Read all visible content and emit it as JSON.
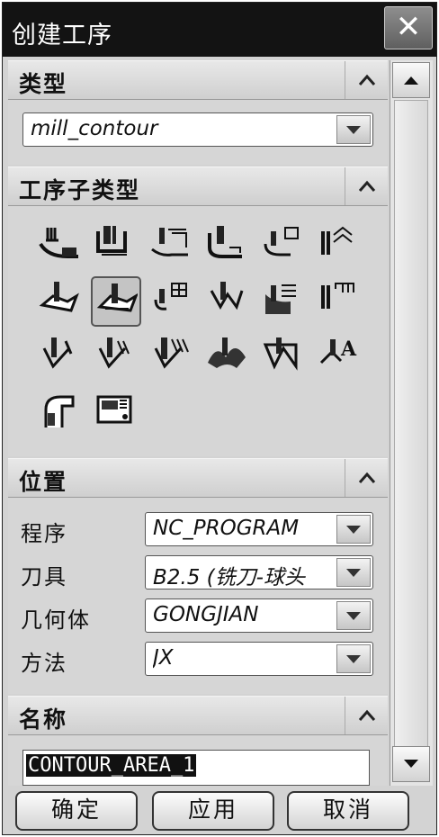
{
  "window": {
    "title": "创建工序",
    "close_label": "✕"
  },
  "sections": {
    "type": {
      "label": "类型",
      "selected_value": "mill_contour"
    },
    "subtype": {
      "label": "工序子类型",
      "icons": [
        "cavity-mill-icon",
        "plunge-milling-icon",
        "corner-rough-icon",
        "rest-milling-icon",
        "zlevel-profile-icon",
        "zlevel-corner-icon",
        "fixed-contour-icon",
        "contour-area-icon",
        "contour-surface-area-icon",
        "streamline-icon",
        "contour-area-non-steep-icon",
        "contour-area-dir-steep-icon",
        "flowcut-single-icon",
        "flowcut-multiple-icon",
        "flowcut-ref-tool-icon",
        "solid-profile-3d-icon",
        "profile-3d-icon",
        "contour-text-icon",
        "mill-user-icon",
        "mill-control-icon"
      ],
      "selected_index": 7
    },
    "location": {
      "label": "位置",
      "rows": [
        {
          "label": "程序",
          "value": "NC_PROGRAM"
        },
        {
          "label": "刀具",
          "value": "B2.5 (铣刀-球头"
        },
        {
          "label": "几何体",
          "value": "GONGJIAN"
        },
        {
          "label": "方法",
          "value": "JX"
        }
      ]
    },
    "name": {
      "label": "名称",
      "value": "CONTOUR_AREA_1"
    }
  },
  "buttons": {
    "ok": "确定",
    "apply": "应用",
    "cancel": "取消"
  },
  "colors": {
    "titlebar": "#131313",
    "panel": "#d3d3d3",
    "header": "#e0e0e0",
    "selection": "#111111"
  }
}
